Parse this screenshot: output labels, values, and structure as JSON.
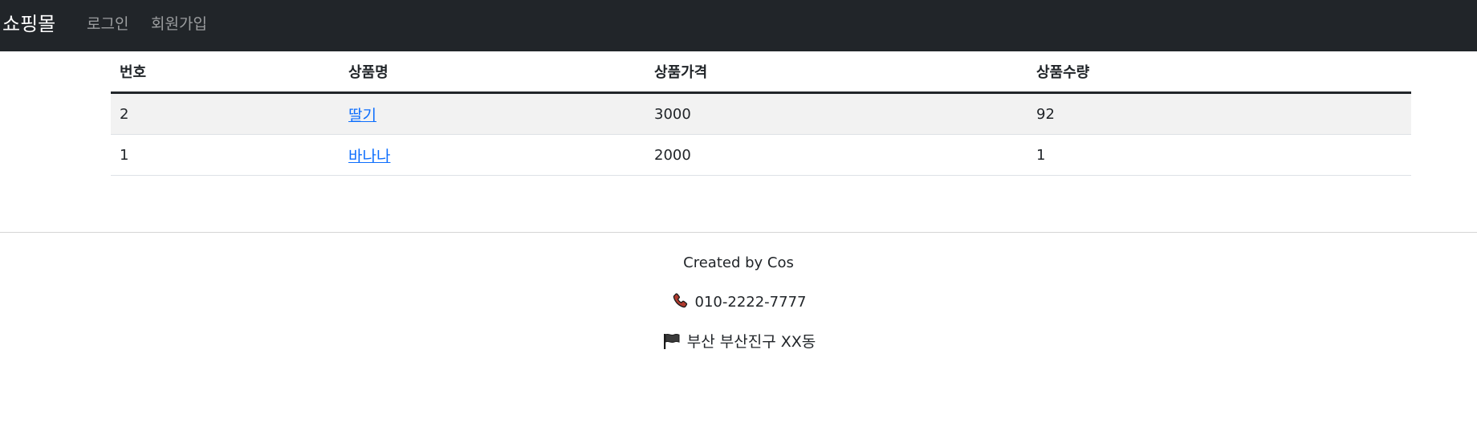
{
  "navbar": {
    "brand": "쇼핑몰",
    "links": [
      "로그인",
      "회원가입"
    ]
  },
  "table": {
    "headers": [
      "번호",
      "상품명",
      "상품가격",
      "상품수량"
    ],
    "rows": [
      {
        "num": "2",
        "name": "딸기",
        "price": "3000",
        "qty": "92"
      },
      {
        "num": "1",
        "name": "바나나",
        "price": "2000",
        "qty": "1"
      }
    ]
  },
  "footer": {
    "created": "Created by Cos",
    "phone": "010-2222-7777",
    "address": "부산 부산진구 XX동",
    "phone_icon": "phone-icon",
    "address_icon": "flag-icon"
  },
  "colors": {
    "navbar_bg": "#212529",
    "link": "#0d6efd",
    "stripe": "#f2f2f2"
  }
}
